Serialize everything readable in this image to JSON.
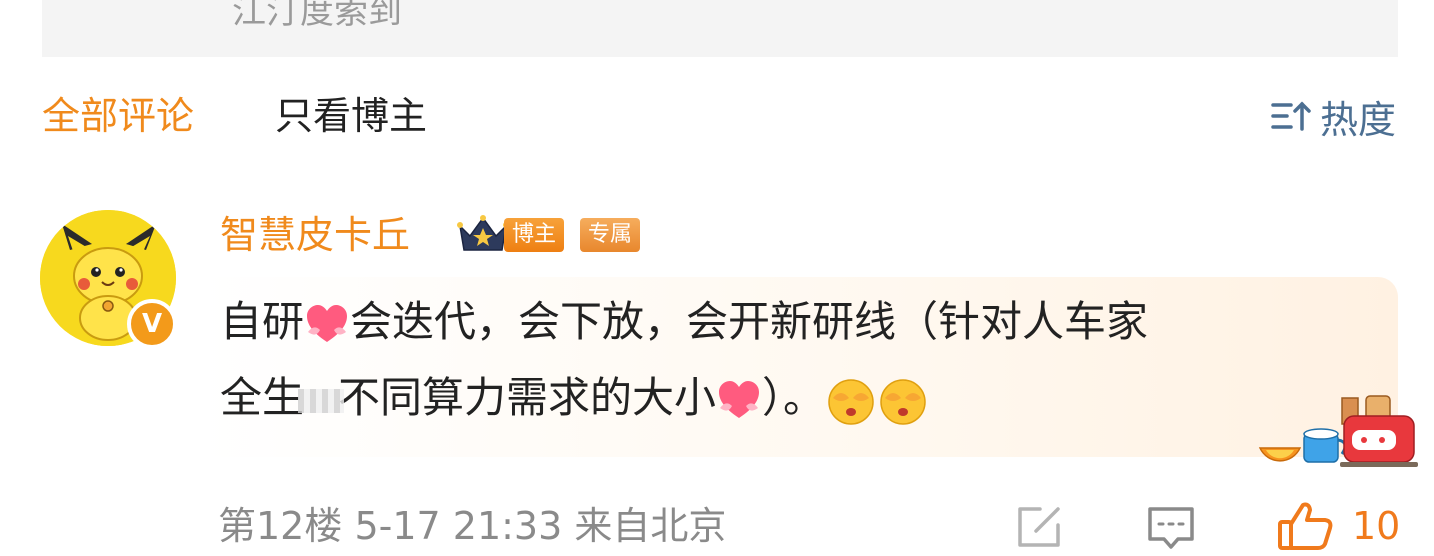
{
  "search_hint": {
    "text": "江汀度索到"
  },
  "tabs": [
    {
      "label": "全部评论",
      "active": true
    },
    {
      "label": "只看博主",
      "active": false
    }
  ],
  "sort": {
    "label": "热度",
    "icon": "sort-icon"
  },
  "comment": {
    "author": "智慧皮卡丘",
    "badges": {
      "owner": "博主",
      "exclusive": "专属"
    },
    "verified_badge": "V",
    "line1": {
      "a": "自研",
      "b": "会迭代，会下放，会开新研线（针对人车家"
    },
    "line2": {
      "a": "全生",
      "b": "不同算力需求的大小",
      "c": "）。"
    },
    "floor": "第12楼",
    "date": "5-17 21:33",
    "location": "来自北京",
    "likes": "10"
  },
  "colors": {
    "accent": "#f08a1c",
    "link": "#4c6f92",
    "meta": "#8a8a8a"
  }
}
